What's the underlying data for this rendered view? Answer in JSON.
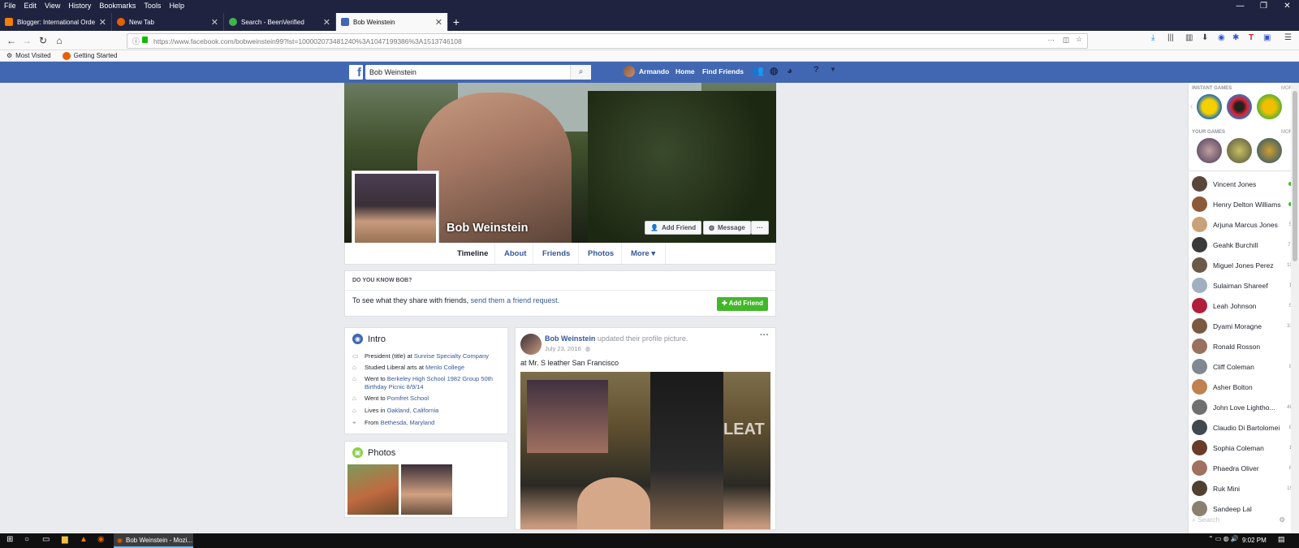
{
  "browser": {
    "menu": [
      "File",
      "Edit",
      "View",
      "History",
      "Bookmarks",
      "Tools",
      "Help"
    ],
    "tabs": [
      {
        "title": "Blogger: International Order Of...",
        "color": "#f57d00"
      },
      {
        "title": "New Tab",
        "color": "#e66000"
      },
      {
        "title": "Search - BeenVerified",
        "color": "#3cb54a"
      },
      {
        "title": "Bob Weinstein",
        "color": "#4267b2"
      }
    ],
    "url": "https://www.facebook.com/bobweinstein99?lst=100002073481240%3A1047199386%3A1513746108",
    "bookmarks": [
      "Most Visited",
      "Getting Started"
    ]
  },
  "fb": {
    "search_value": "Bob Weinstein",
    "nav": {
      "user": "Armando",
      "home": "Home",
      "find_friends": "Find Friends"
    }
  },
  "profile": {
    "name": "Bob Weinstein",
    "add_friend": "Add Friend",
    "message": "Message",
    "more_dots": "···",
    "tabs": [
      "Timeline",
      "About",
      "Friends",
      "Photos",
      "More ▾"
    ]
  },
  "know": {
    "heading": "DO YOU KNOW BOB?",
    "text": "To see what they share with friends,",
    "link": "send them a friend request.",
    "button": "Add Friend"
  },
  "intro": {
    "title": "Intro",
    "items": [
      {
        "pre": "President (title) at ",
        "link": "Sunrise Specialty Company",
        "post": ""
      },
      {
        "pre": "Studied Liberal arts at ",
        "link": "Menlo College",
        "post": ""
      },
      {
        "pre": "Went to ",
        "link": "Berkeley High School 1982 Group 50th Birthday Picnic 8/9/14",
        "post": ""
      },
      {
        "pre": "Went to ",
        "link": "Pomfret School",
        "post": ""
      },
      {
        "pre": "Lives in ",
        "link": "Oakland, California",
        "post": ""
      },
      {
        "pre": "From ",
        "link": "Bethesda, Maryland",
        "post": ""
      }
    ]
  },
  "photos": {
    "title": "Photos"
  },
  "post": {
    "author": "Bob Weinstein",
    "action": "updated their profile picture.",
    "date": "July 23, 2016",
    "caption": "at Mr. S leather San Francisco",
    "menu": "···"
  },
  "chat": {
    "instant_games": "INSTANT GAMES",
    "your_games": "YOUR GAMES",
    "more": "MORE",
    "contacts": [
      {
        "name": "Vincent Jones",
        "status": "online",
        "color": "#5a4638"
      },
      {
        "name": "Henry Delton Williams",
        "status": "online",
        "color": "#8a5a3a"
      },
      {
        "name": "Arjuna Marcus Jones",
        "status": "5h",
        "color": "#c9a27a"
      },
      {
        "name": "Geahk Burchill",
        "status": "7m",
        "color": "#3a3a3a"
      },
      {
        "name": "Miguel Jones Perez",
        "status": "11m",
        "color": "#6b5a4a"
      },
      {
        "name": "Sulaiman Shareef",
        "status": "1h",
        "color": "#a0b0c0"
      },
      {
        "name": "Leah Johnson",
        "status": "5h",
        "color": "#b0203a"
      },
      {
        "name": "Dyami Moragne",
        "status": "31m",
        "color": "#7a5a40"
      },
      {
        "name": "Ronald Rosson",
        "status": "",
        "color": "#9a7060"
      },
      {
        "name": "Cliff Coleman",
        "status": "8h",
        "color": "#808890"
      },
      {
        "name": "Asher Bolton",
        "status": "",
        "color": "#c08050"
      },
      {
        "name": "John Love Lightho...",
        "status": "48m",
        "color": "#707070"
      },
      {
        "name": "Claudio Di Bartolomei",
        "status": "8h",
        "color": "#404850"
      },
      {
        "name": "Sophia Coleman",
        "status": "1h",
        "color": "#6a3a2a"
      },
      {
        "name": "Phaedra Oliver",
        "status": "6h",
        "color": "#a07060"
      },
      {
        "name": "Ruk Mini",
        "status": "19m",
        "color": "#504030"
      },
      {
        "name": "Sandeep Lal",
        "status": "",
        "color": "#8a8070"
      }
    ],
    "search_placeholder": "Search"
  },
  "taskbar": {
    "active": "Bob Weinstein - Mozi...",
    "time": "9:02 PM"
  }
}
